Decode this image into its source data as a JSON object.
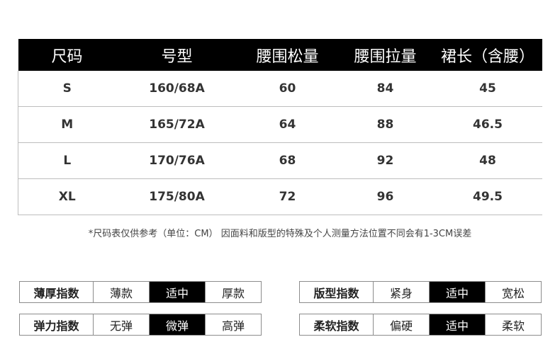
{
  "size_table": {
    "headers": [
      "尺码",
      "号型",
      "腰围松量",
      "腰围拉量",
      "裙长（含腰）"
    ],
    "rows": [
      [
        "S",
        "160/68A",
        "60",
        "84",
        "45"
      ],
      [
        "M",
        "165/72A",
        "64",
        "88",
        "46.5"
      ],
      [
        "L",
        "170/76A",
        "68",
        "92",
        "48"
      ],
      [
        "XL",
        "175/80A",
        "72",
        "96",
        "49.5"
      ]
    ]
  },
  "note": "*尺码表仅供参考（单位：CM） 因面料和版型的特殊及个人测量方法位置不同会有1-3CM误差",
  "indices": {
    "thickness": {
      "label": "薄厚指数",
      "options": [
        "薄款",
        "适中",
        "厚款"
      ],
      "selected": "适中"
    },
    "fit": {
      "label": "版型指数",
      "options": [
        "紧身",
        "适中",
        "宽松"
      ],
      "selected": "适中"
    },
    "elasticity": {
      "label": "弹力指数",
      "options": [
        "无弹",
        "微弹",
        "高弹"
      ],
      "selected": "微弹"
    },
    "softness": {
      "label": "柔软指数",
      "options": [
        "偏硬",
        "适中",
        "柔软"
      ],
      "selected": "适中"
    }
  },
  "colors": {
    "header_bg": "#000000",
    "selected_bg": "#000000",
    "border": "#bdbdbd"
  }
}
